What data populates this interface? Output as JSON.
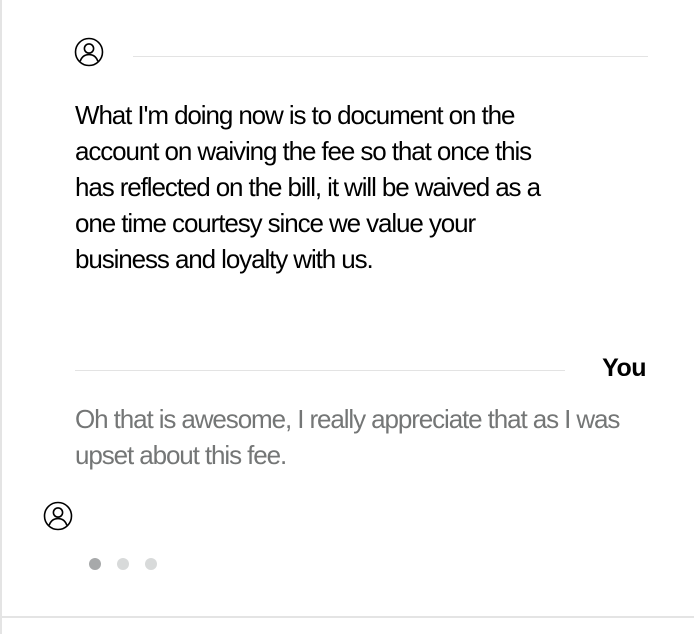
{
  "conversation": {
    "agent_message": {
      "avatar_icon": "user-circle-icon",
      "text": "What I'm doing now is to document on the account on waiving the fee so that once this has reflected on the bill, it will be waived as a one time courtesy since we value your business and loyalty with us."
    },
    "user_message": {
      "sender": "You",
      "text": "Oh that is awesome, I really appreciate that as I was upset about this fee."
    },
    "typing_indicator": {
      "avatar_icon": "user-circle-icon",
      "dot_count": 3,
      "active_dot": 1
    }
  },
  "colors": {
    "agent_text": "#000000",
    "user_text": "#747676",
    "divider": "#e3e3e3",
    "dot_active": "#a7a9aa",
    "dot_inactive": "#d8dada"
  }
}
